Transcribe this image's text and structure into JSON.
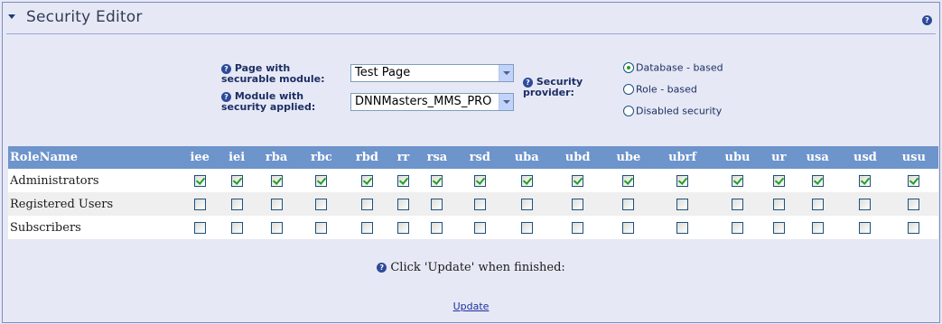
{
  "header": {
    "title": "Security Editor"
  },
  "form": {
    "page_label": "Page with securable module:",
    "page_value": "Test Page",
    "module_label": "Module with security applied:",
    "module_value": "DNNMasters_MMS_PRO",
    "provider_label": "Security provider:",
    "provider_options": [
      "Database - based",
      "Role - based",
      "Disabled security"
    ],
    "provider_selected": "Database - based"
  },
  "grid": {
    "rolename_header": "RoleName",
    "permissions": [
      "iee",
      "iei",
      "rba",
      "rbc",
      "rbd",
      "rr",
      "rsa",
      "rsd",
      "uba",
      "ubd",
      "ube",
      "ubrf",
      "ubu",
      "ur",
      "usa",
      "usd",
      "usu"
    ],
    "roles": [
      {
        "name": "Administrators",
        "checked": [
          true,
          true,
          true,
          true,
          true,
          true,
          true,
          true,
          true,
          true,
          true,
          true,
          true,
          true,
          true,
          true,
          true
        ]
      },
      {
        "name": "Registered Users",
        "checked": [
          false,
          false,
          false,
          false,
          false,
          false,
          false,
          false,
          false,
          false,
          false,
          false,
          false,
          false,
          false,
          false,
          false
        ]
      },
      {
        "name": "Subscribers",
        "checked": [
          false,
          false,
          false,
          false,
          false,
          false,
          false,
          false,
          false,
          false,
          false,
          false,
          false,
          false,
          false,
          false,
          false
        ]
      }
    ]
  },
  "footer": {
    "note": "Click 'Update' when finished:",
    "update_label": "Update"
  },
  "colors": {
    "header_row": "#6D94CB",
    "check_green": "#21A121",
    "label_navy": "#1C2E63"
  }
}
